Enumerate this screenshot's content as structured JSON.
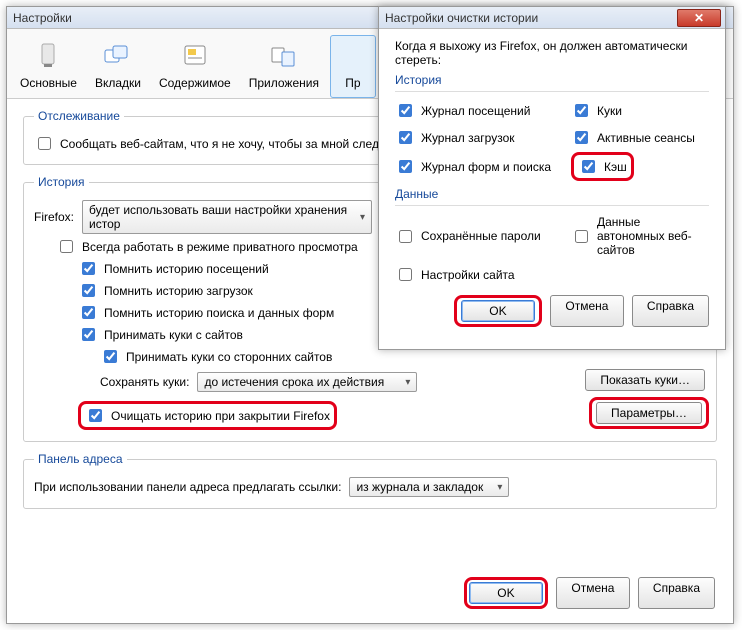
{
  "mainWindow": {
    "title": "Настройки",
    "tabs": [
      {
        "label": "Основные"
      },
      {
        "label": "Вкладки"
      },
      {
        "label": "Содержимое"
      },
      {
        "label": "Приложения"
      },
      {
        "label": "Пр"
      }
    ],
    "tracking": {
      "legend": "Отслеживание",
      "dnt": "Сообщать веб-сайтам, что я не хочу, чтобы за мной след"
    },
    "history": {
      "legend": "История",
      "firefoxLabel": "Firefox:",
      "modeDropdown": "будет использовать ваши настройки хранения истор",
      "alwaysPrivate": "Всегда работать в режиме приватного просмотра",
      "rememberBrowsing": "Помнить историю посещений",
      "rememberDownloads": "Помнить историю загрузок",
      "rememberForms": "Помнить историю поиска и данных форм",
      "acceptCookies": "Принимать куки с сайтов",
      "acceptThirdParty": "Принимать куки со сторонних сайтов",
      "keepCookiesLabel": "Сохранять куки:",
      "keepCookiesDropdown": "до истечения срока их действия",
      "showCookiesBtn": "Показать куки…",
      "clearOnClose": "Очищать историю при закрытии Firefox",
      "settingsBtn": "Параметры…"
    },
    "addressBar": {
      "legend": "Панель адреса",
      "suggestLabel": "При использовании панели адреса предлагать ссылки:",
      "suggestDropdown": "из журнала и закладок"
    },
    "buttons": {
      "ok": "OK",
      "cancel": "Отмена",
      "help": "Справка"
    }
  },
  "dialog": {
    "title": "Настройки очистки истории",
    "intro": "Когда я выхожу из Firefox, он должен автоматически стереть:",
    "historySection": "История",
    "items": {
      "browsingLog": "Журнал посещений",
      "cookies": "Куки",
      "downloadLog": "Журнал загрузок",
      "activeSessions": "Активные сеансы",
      "formLog": "Журнал форм и поиска",
      "cache": "Кэш"
    },
    "dataSection": "Данные",
    "dataItems": {
      "savedPasswords": "Сохранённые пароли",
      "offlineData": "Данные автономных веб-сайтов",
      "siteSettings": "Настройки сайта"
    },
    "buttons": {
      "ok": "OK",
      "cancel": "Отмена",
      "help": "Справка"
    }
  }
}
